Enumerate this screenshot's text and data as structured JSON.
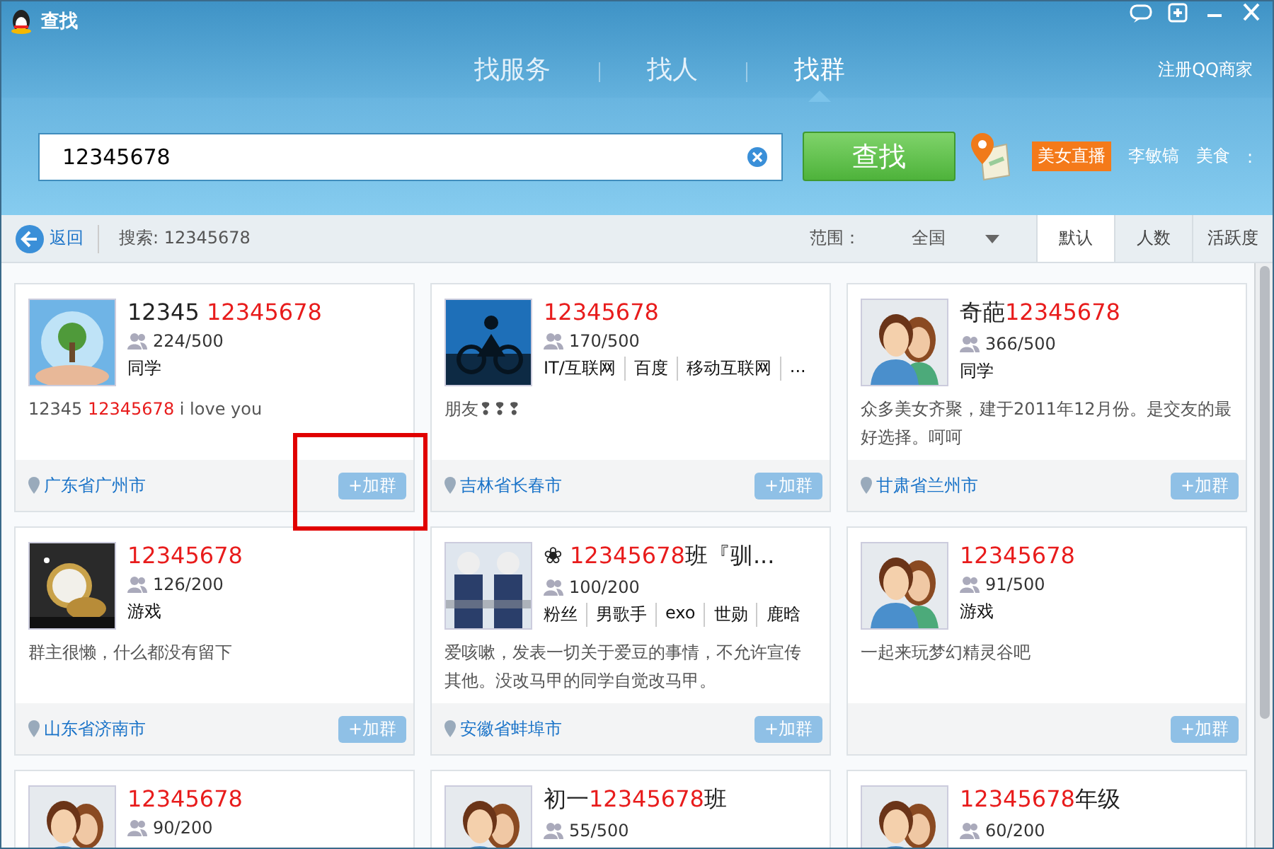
{
  "window": {
    "title": "查找"
  },
  "nav_tabs": [
    {
      "label": "找服务",
      "selected": false
    },
    {
      "label": "找人",
      "selected": false
    },
    {
      "label": "找群",
      "selected": true
    }
  ],
  "register_link": "注册QQ商家",
  "search": {
    "value": "12345678",
    "button": "查找"
  },
  "hot_tags": [
    {
      "label": "美女直播",
      "kind": "highlight"
    },
    {
      "label": "李敏镐",
      "kind": "plain"
    },
    {
      "label": "美食",
      "kind": "plain"
    },
    {
      "label": ":",
      "kind": "plain"
    }
  ],
  "filter_bar": {
    "back": "返回",
    "query": "搜索: 12345678",
    "scope_label": "范围：",
    "scope_value": "全国"
  },
  "sort_tabs": [
    {
      "label": "默认",
      "selected": true
    },
    {
      "label": "人数",
      "selected": false
    },
    {
      "label": "活跃度",
      "selected": false
    }
  ],
  "groups": [
    {
      "kind": "picture",
      "name": [
        {
          "text": "12345 ",
          "match": false
        },
        {
          "text": "12345678",
          "match": true
        }
      ],
      "members": "224/500",
      "tags": [
        "同学"
      ],
      "description": [
        {
          "text": "12345 ",
          "match": false
        },
        {
          "text": "12345678",
          "match": true
        },
        {
          "text": " i love you",
          "match": false
        }
      ],
      "location": "广东省广州市",
      "join": "+加群"
    },
    {
      "kind": "picture",
      "name": [
        {
          "text": "12345678",
          "match": true
        }
      ],
      "members": "170/500",
      "tags": [
        "IT/互联网",
        "百度",
        "移动互联网",
        "..."
      ],
      "description": [
        {
          "text": "朋友❢❢❢",
          "match": false
        }
      ],
      "location": "吉林省长春市",
      "join": "+加群"
    },
    {
      "kind": "avatar",
      "name": [
        {
          "text": "奇葩",
          "match": false
        },
        {
          "text": "12345678",
          "match": true
        }
      ],
      "members": "366/500",
      "tags": [
        "同学"
      ],
      "description": [
        {
          "text": "众多美女齐聚，建于2011年12月份。是交友的最好选择。呵呵",
          "match": false
        }
      ],
      "location": "甘肃省兰州市",
      "join": "+加群"
    },
    {
      "kind": "picture",
      "name": [
        {
          "text": "12345678",
          "match": true
        }
      ],
      "members": "126/200",
      "tags": [
        "游戏"
      ],
      "description": [
        {
          "text": "群主很懒，什么都没有留下",
          "match": false
        }
      ],
      "location": "山东省济南市",
      "join": "+加群"
    },
    {
      "kind": "picture",
      "name": [
        {
          "text": "❀ ",
          "match": false
        },
        {
          "text": "12345678",
          "match": true
        },
        {
          "text": "班『驯...",
          "match": false
        }
      ],
      "members": "100/200",
      "tags": [
        "粉丝",
        "男歌手",
        "exo",
        "世勋",
        "鹿晗"
      ],
      "description": [
        {
          "text": "爱咳嗽，发表一切关于爱豆的事情，不允许宣传其他。没改马甲的同学自觉改马甲。",
          "match": false
        }
      ],
      "location": "安徽省蚌埠市",
      "join": "+加群"
    },
    {
      "kind": "avatar",
      "name": [
        {
          "text": "12345678",
          "match": true
        }
      ],
      "members": "91/500",
      "tags": [
        "游戏"
      ],
      "description": [
        {
          "text": "一起来玩梦幻精灵谷吧",
          "match": false
        }
      ],
      "join": "+加群"
    },
    {
      "kind": "avatar",
      "name": [
        {
          "text": "12345678",
          "match": true
        }
      ],
      "members": "90/200"
    },
    {
      "kind": "avatar",
      "name": [
        {
          "text": "初一",
          "match": false
        },
        {
          "text": "12345678",
          "match": true
        },
        {
          "text": "班",
          "match": false
        }
      ],
      "members": "55/500"
    },
    {
      "kind": "avatar",
      "name": [
        {
          "text": "12345678",
          "match": true
        },
        {
          "text": "年级",
          "match": false
        }
      ],
      "members": "60/200"
    }
  ]
}
